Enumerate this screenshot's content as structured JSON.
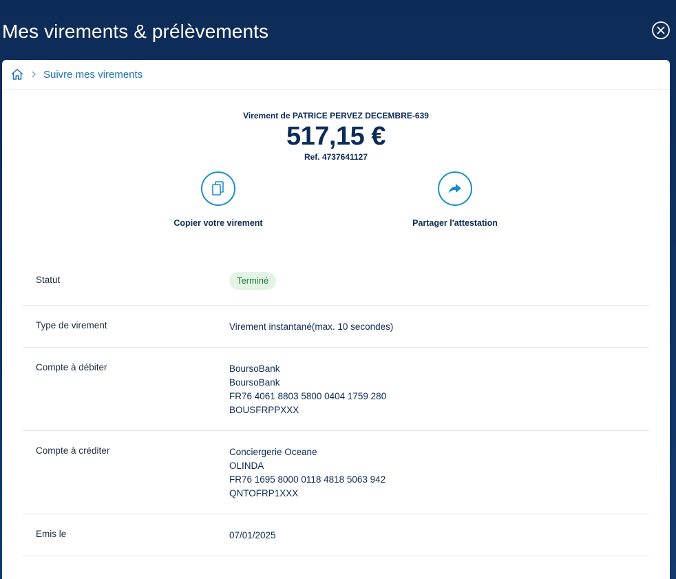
{
  "header": {
    "title": "Mes virements & prélèvements"
  },
  "breadcrumb": {
    "current": "Suivre mes virements"
  },
  "summary": {
    "label": "Virement de PATRICE PERVEZ DECEMBRE-639",
    "amount": "517,15 €",
    "reference": "Ref. 4737641127"
  },
  "actions": {
    "copy_label": "Copier votre virement",
    "share_label": "Partager l'attestation"
  },
  "details": {
    "status": {
      "key": "Statut",
      "value": "Terminé"
    },
    "type": {
      "key": "Type de virement",
      "value": "Virement instantané(max. 10 secondes)"
    },
    "debit": {
      "key": "Compte à débiter",
      "lines": [
        "BoursoBank",
        "BoursoBank",
        "FR76 4061 8803 5800 0404 1759 280",
        "BOUSFRPPXXX"
      ]
    },
    "credit": {
      "key": "Compte à créditer",
      "lines": [
        "Conciergerie Oceane",
        "OLINDA",
        "FR76 1695 8000 0118 4818 5063 942",
        "QNTOFRP1XXX"
      ]
    },
    "date": {
      "key": "Emis le",
      "value": "07/01/2025"
    }
  },
  "colors": {
    "header_bg": "#0d2b57",
    "accent": "#1a8ec9",
    "link": "#1a73b5",
    "status_bg": "#e3f4e6",
    "status_text": "#1f7a33"
  },
  "icons": [
    "close-icon",
    "home-icon",
    "chevron-right-icon",
    "copy-icon",
    "share-arrow-icon"
  ]
}
